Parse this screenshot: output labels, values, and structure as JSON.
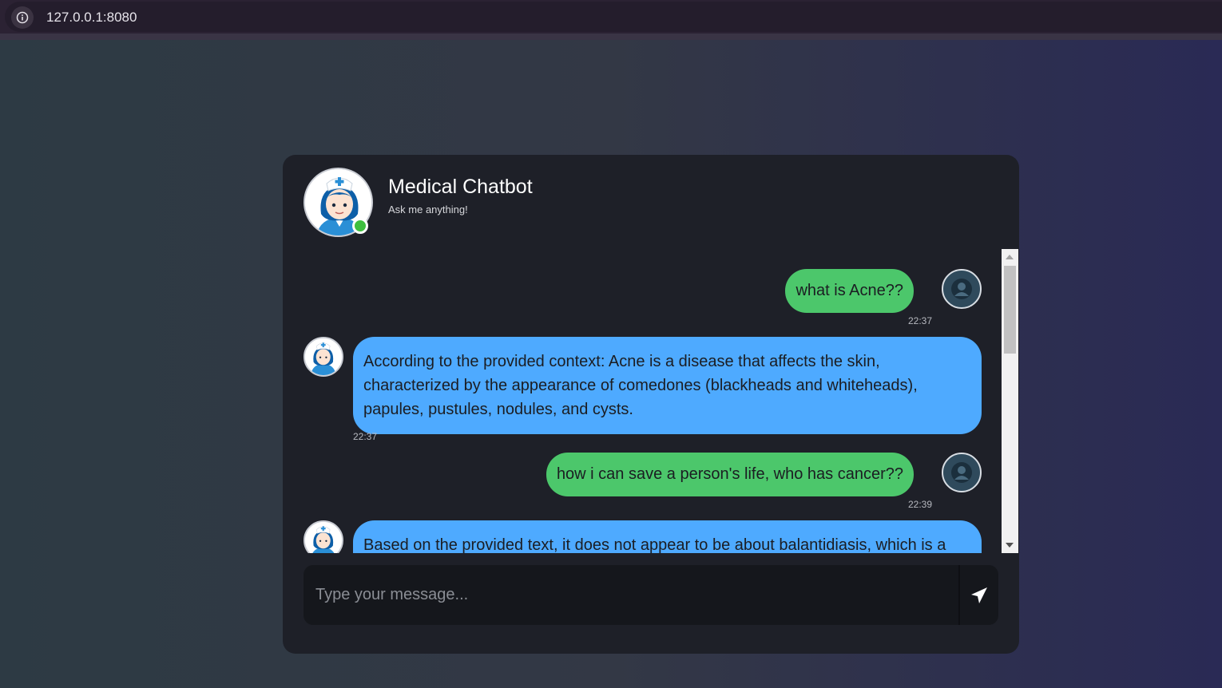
{
  "browser": {
    "url": "127.0.0.1:8080"
  },
  "chat": {
    "title": "Medical Chatbot",
    "subtitle": "Ask me anything!",
    "messages": [
      {
        "sender": "user",
        "text": "what is Acne??",
        "time": "22:37"
      },
      {
        "sender": "bot",
        "text": "According to the provided context: Acne is a disease that affects the skin, characterized by the appearance of comedones (blackheads and whiteheads), papules, pustules, nodules, and cysts.",
        "time": "22:37"
      },
      {
        "sender": "user",
        "text": "how i can save a person's life, who has cancer??",
        "time": "22:39"
      },
      {
        "sender": "bot",
        "text": "Based on the provided text, it does not appear to be about balantidiasis, which is a",
        "time": ""
      }
    ],
    "input_placeholder": "Type your message..."
  },
  "colors": {
    "user_bubble": "#4cc76b",
    "bot_bubble": "#4eaaff",
    "online": "#3fbf3f",
    "card": "#1e2028"
  },
  "icons": {
    "info": "info-icon",
    "send": "paper-plane-icon",
    "user": "user-avatar-icon",
    "bot": "nurse-avatar-icon"
  }
}
